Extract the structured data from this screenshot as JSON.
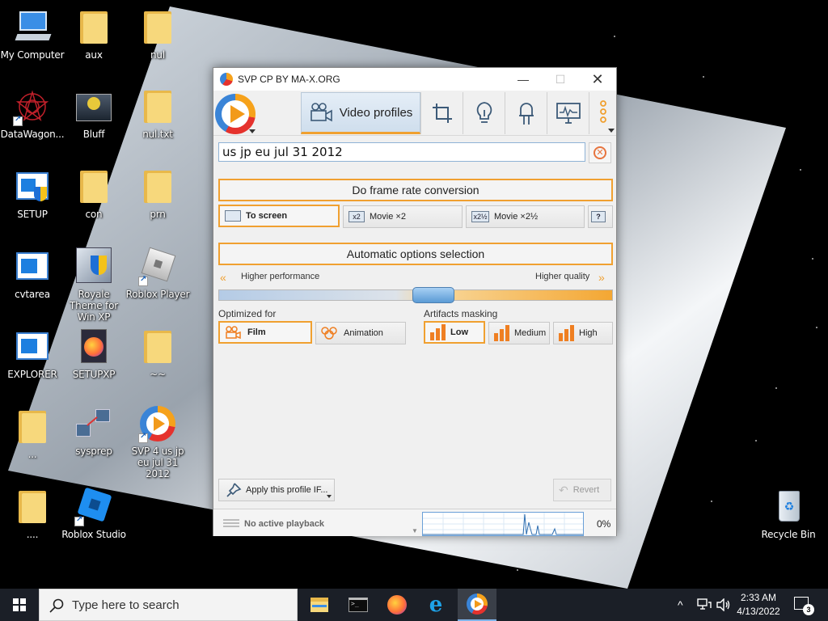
{
  "desktop": {
    "icons": [
      {
        "label": "My Computer"
      },
      {
        "label": "aux"
      },
      {
        "label": "nul"
      },
      {
        "label": "DataWagon..."
      },
      {
        "label": "Bluff"
      },
      {
        "label": "nul.txt"
      },
      {
        "label": "SETUP"
      },
      {
        "label": "con"
      },
      {
        "label": "prn"
      },
      {
        "label": "cvtarea"
      },
      {
        "label": "Royale Theme for Win XP"
      },
      {
        "label": "Roblox Player"
      },
      {
        "label": "EXPLORER"
      },
      {
        "label": "SETUPXP"
      },
      {
        "label": "~~"
      },
      {
        "label": "..."
      },
      {
        "label": "sysprep"
      },
      {
        "label": "SVP 4 us jp eu jul 31 2012"
      },
      {
        "label": "...."
      },
      {
        "label": "Roblox Studio"
      },
      {
        "label": "Recycle Bin"
      }
    ]
  },
  "svp": {
    "title": "SVP CP BY MA-X.ORG",
    "toolbar": {
      "active_tab": "Video profiles"
    },
    "profile_name": "us jp eu jul 31 2012",
    "frame_rate_button": "Do frame rate conversion",
    "modes": {
      "to_screen": "To screen",
      "movie_x2": "Movie ×2",
      "movie_x2_icon": "x2",
      "movie_x25": "Movie ×2½",
      "movie_x25_icon": "x2½",
      "help_icon": "?"
    },
    "auto_button": "Automatic options selection",
    "slider": {
      "left_label": "Higher performance",
      "right_label": "Higher quality",
      "position": 0.55
    },
    "optimized_for": {
      "heading": "Optimized for",
      "film": "Film",
      "animation": "Animation"
    },
    "artifacts": {
      "heading": "Artifacts masking",
      "low": "Low",
      "medium": "Medium",
      "high": "High"
    },
    "apply_button": "Apply this profile IF...",
    "revert_button": "Revert",
    "status": "No active playback",
    "cpu_percent": "0%"
  },
  "taskbar": {
    "search_placeholder": "Type here to search",
    "time": "2:33 AM",
    "date": "4/13/2022",
    "notification_count": "3"
  }
}
